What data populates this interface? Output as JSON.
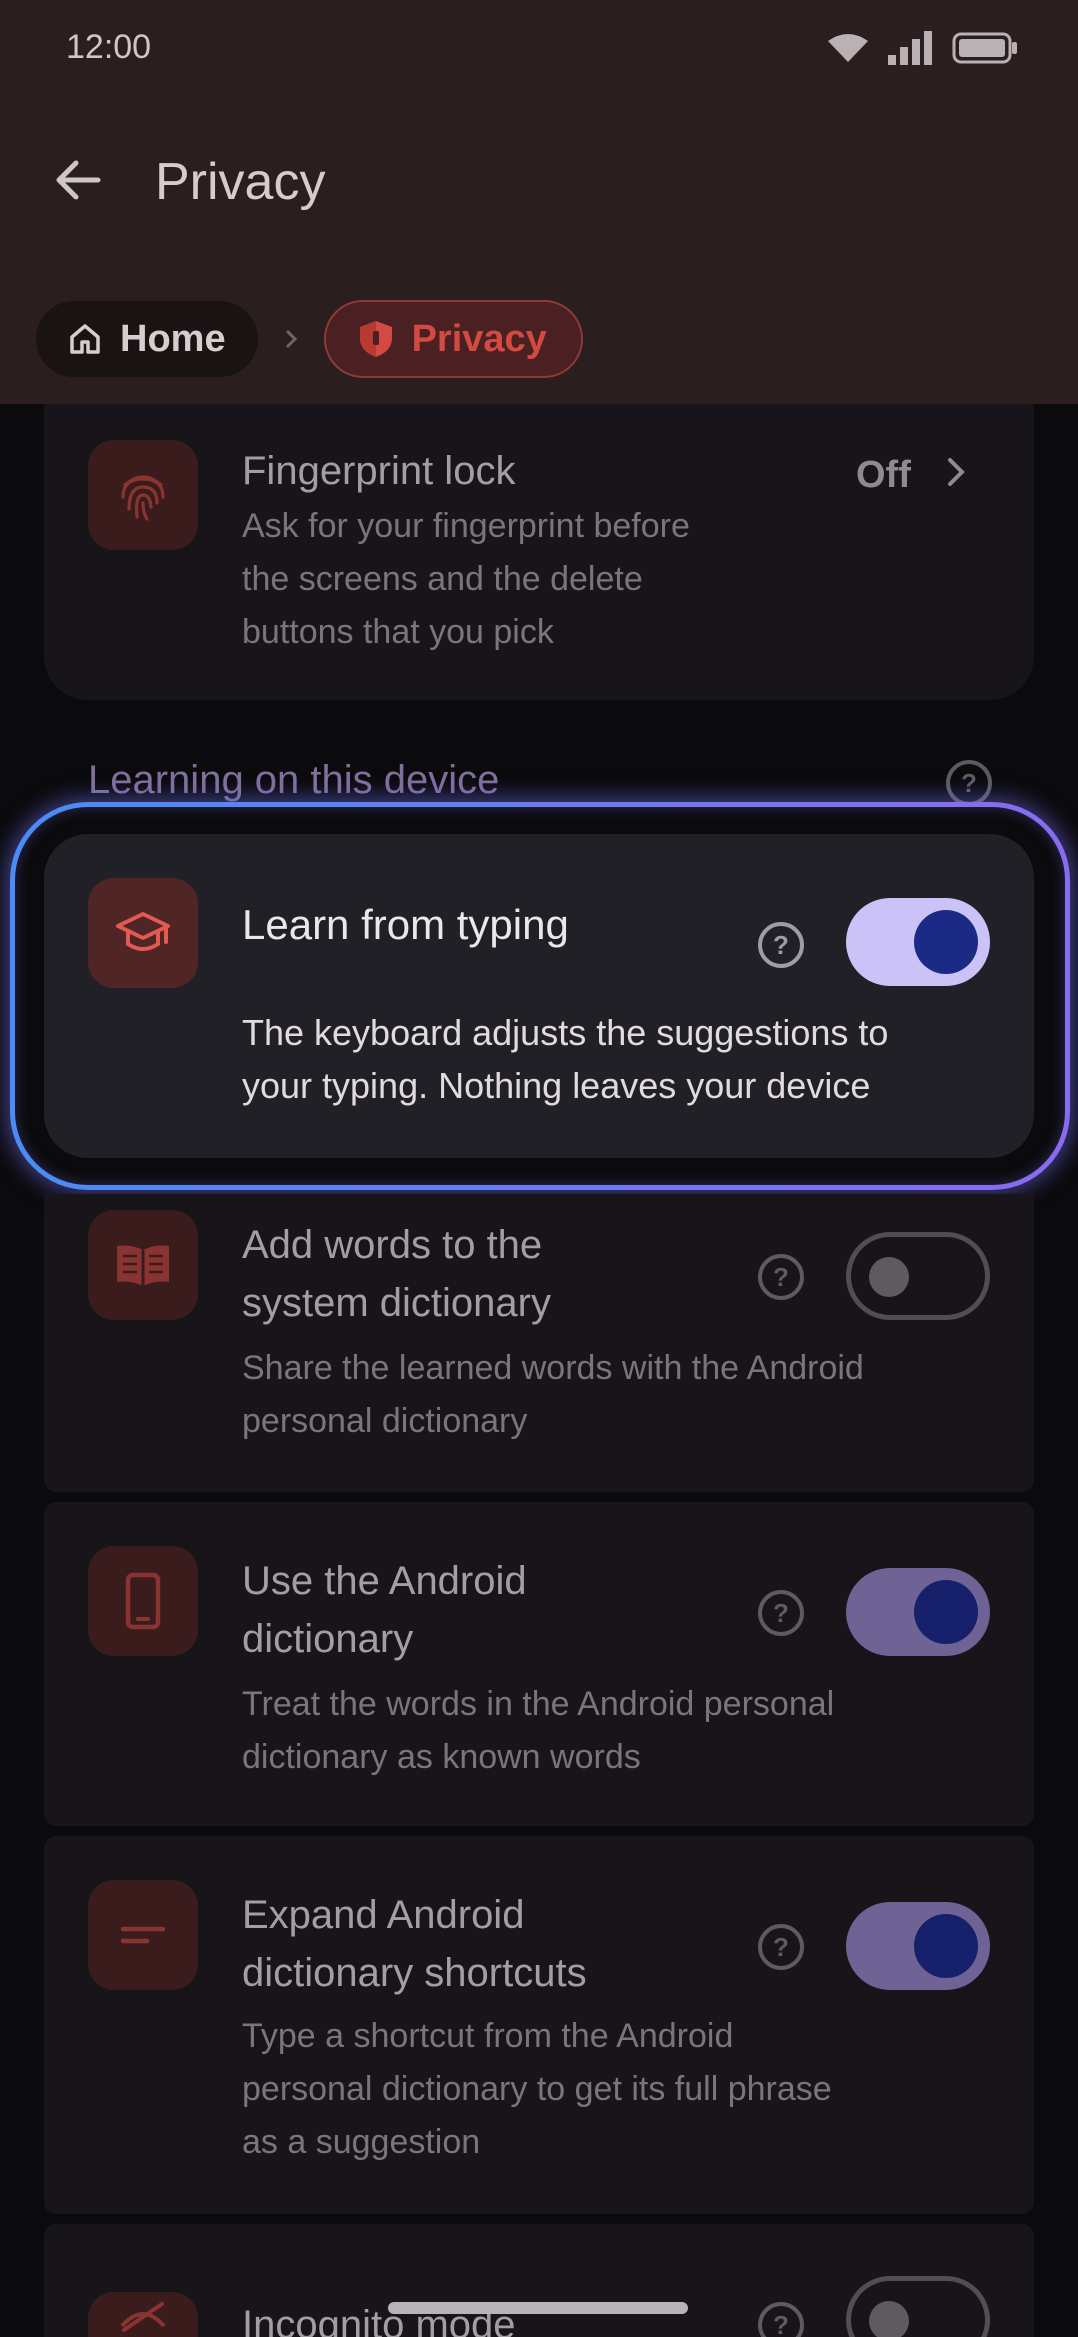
{
  "status_bar": {
    "time": "12:00"
  },
  "app_bar": {
    "title": "Privacy"
  },
  "breadcrumb": {
    "home": "Home",
    "current": "Privacy"
  },
  "fingerprint": {
    "title": "Fingerprint lock",
    "value": "Off",
    "desc_lines": [
      "Ask for your fingerprint before",
      "the screens and the delete",
      "buttons that you pick"
    ]
  },
  "section": {
    "label": "Learning on this device"
  },
  "learn": {
    "title": "Learn from typing",
    "toggle_on": true,
    "desc_lines": [
      "The keyboard adjusts the suggestions to",
      "your typing. Nothing leaves your device"
    ]
  },
  "add_words": {
    "title_lines": [
      "Add words to the",
      "system dictionary"
    ],
    "toggle_on": false,
    "desc_lines": [
      "Share the learned words with the Android",
      "personal dictionary"
    ]
  },
  "android_dict": {
    "title_lines": [
      "Use the Android",
      "dictionary"
    ],
    "toggle_on": true,
    "desc_lines": [
      "Treat the words in the Android personal",
      "dictionary as known words"
    ]
  },
  "shortcuts": {
    "title_lines": [
      "Expand Android",
      "dictionary shortcuts"
    ],
    "toggle_on": true,
    "desc_lines": [
      "Type a shortcut from the Android",
      "personal dictionary to get its full phrase",
      "as a suggestion"
    ]
  },
  "incognito": {
    "title": "Incognito mode",
    "toggle_on": false
  },
  "colors": {
    "accent": "#d24a42",
    "toggle_on": "#cbc3f7",
    "header_bg": "#2b1e1f"
  }
}
